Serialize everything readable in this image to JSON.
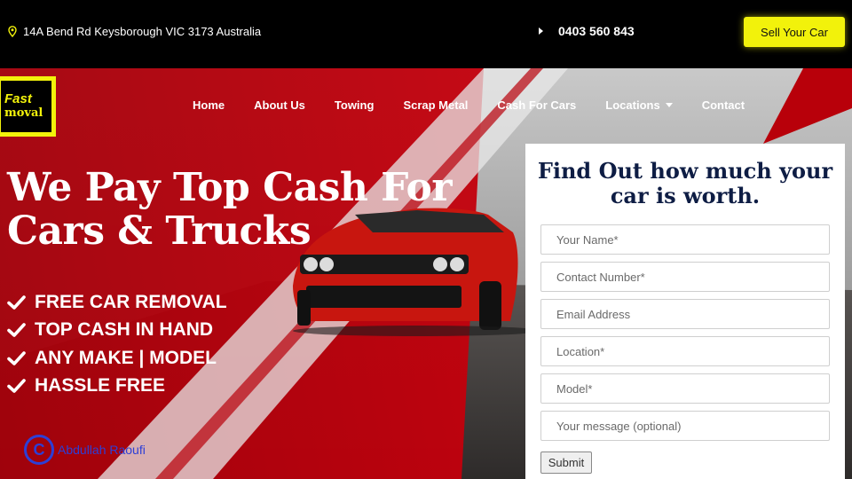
{
  "topbar": {
    "address": "14A Bend Rd Keysborough VIC 3173 Australia",
    "phone": "0403 560 843",
    "cta_label": "Sell Your Car",
    "accent_color": "#f2f20b"
  },
  "logo": {
    "line1": "Fast",
    "line2": "moval"
  },
  "nav": {
    "items": [
      {
        "label": "Home"
      },
      {
        "label": "About Us"
      },
      {
        "label": "Towing"
      },
      {
        "label": "Scrap Metal"
      },
      {
        "label": "Cash For Cars"
      },
      {
        "label": "Locations"
      },
      {
        "label": "Contact"
      }
    ]
  },
  "hero": {
    "headline_line1": "We Pay Top Cash For",
    "headline_line2": "Cars & Trucks",
    "features": [
      "FREE CAR REMOVAL",
      "TOP CASH IN HAND",
      "ANY MAKE | MODEL",
      "HASSLE FREE"
    ],
    "brand_color": "#b8000a"
  },
  "watermark": {
    "symbol": "C",
    "text": "Abdullah Raoufi"
  },
  "form": {
    "title": "Find Out how much your car is worth.",
    "fields": [
      {
        "placeholder": "Your Name*"
      },
      {
        "placeholder": "Contact Number*"
      },
      {
        "placeholder": "Email Address"
      },
      {
        "placeholder": "Location*"
      },
      {
        "placeholder": "Model*"
      },
      {
        "placeholder": "Your message (optional)"
      }
    ],
    "submit_label": "Submit"
  }
}
